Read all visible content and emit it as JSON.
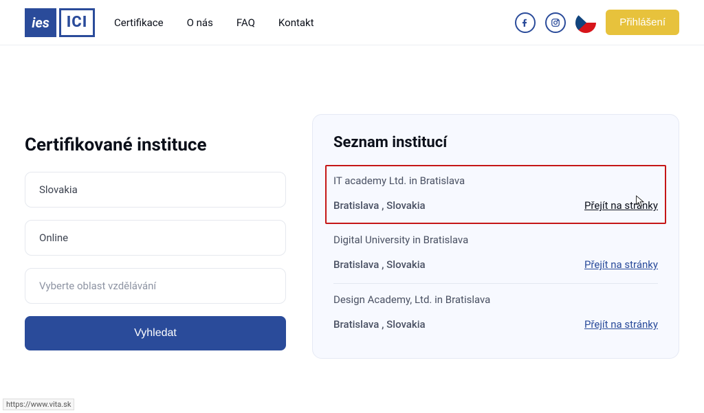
{
  "header": {
    "logo1": "ies",
    "logo2": "ICI",
    "nav": {
      "certifikace": "Certifikace",
      "onas": "O nás",
      "faq": "FAQ",
      "kontakt": "Kontakt"
    },
    "login": "Přihlášení"
  },
  "left": {
    "title": "Certifikované instituce",
    "country": "Slovakia",
    "mode": "Online",
    "area_placeholder": "Vyberte oblast vzdělávání",
    "search": "Vyhledat"
  },
  "right": {
    "title": "Seznam institucí",
    "items": [
      {
        "name": "IT academy Ltd. in Bratislava",
        "location": "Bratislava , Slovakia",
        "link": "Přejít na stránky"
      },
      {
        "name": "Digital University in Bratislava",
        "location": "Bratislava , Slovakia",
        "link": "Přejít na stránky"
      },
      {
        "name": "Design Academy, Ltd. in Bratislava",
        "location": "Bratislava , Slovakia",
        "link": "Přejít na stránky"
      }
    ]
  },
  "status_url": "https://www.vita.sk"
}
